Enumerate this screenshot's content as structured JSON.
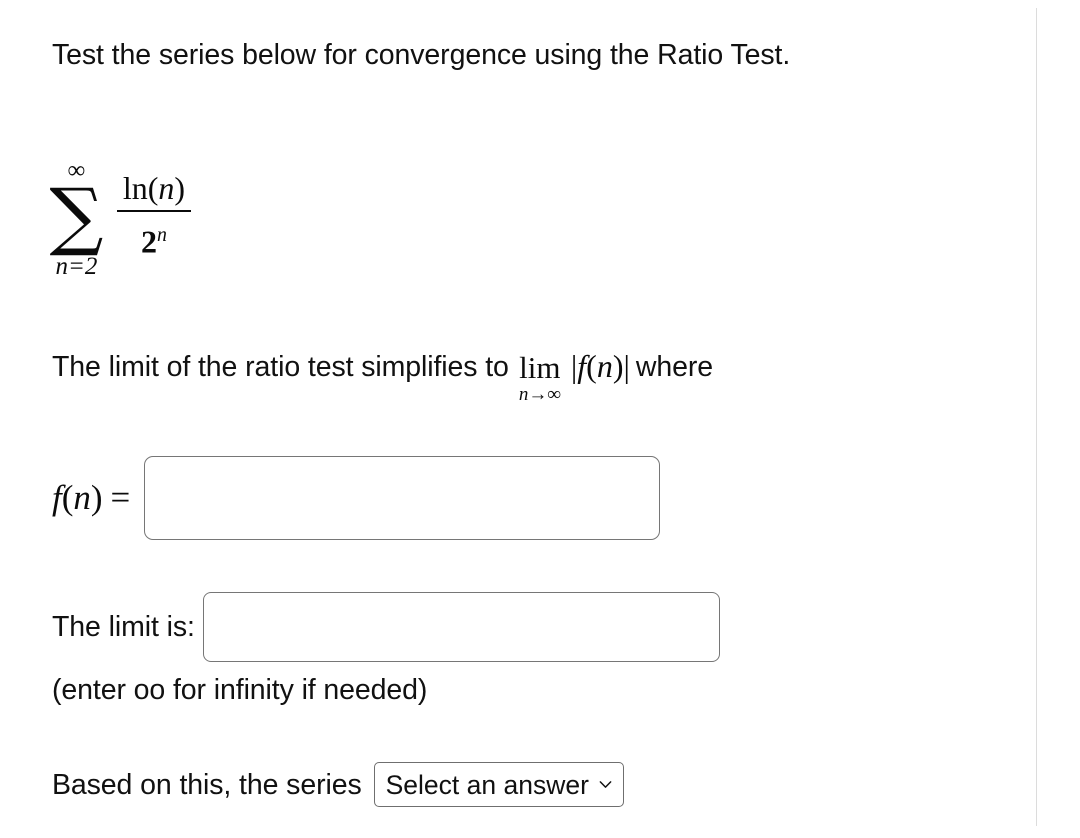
{
  "page": {
    "background_color": "#ffffff",
    "text_color": "#111111",
    "rule_color": "#dcdcdc"
  },
  "question": {
    "heading": "Test the series below for convergence using the Ratio Test."
  },
  "series": {
    "operator": "∑",
    "upper_limit": "∞",
    "lower_limit_var": "n",
    "lower_limit_eq": "=",
    "lower_limit_value": "2",
    "lower_limit_full": "n=2",
    "numerator_fn": "ln",
    "numerator_open": "(",
    "numerator_var": "n",
    "numerator_close": ")",
    "numerator_full": "ln(n)",
    "denominator_base": "2",
    "denominator_exponent": "n",
    "denominator_full": "2ⁿ",
    "plain_text": "sum from n=2 to infinity of ln(n)/2^n"
  },
  "limit_sentence": {
    "lead_text": "The limit of the ratio test simplifies to",
    "lim_operator": "lim",
    "lim_subscript_var": "n",
    "lim_subscript_arrow": "→",
    "lim_subscript_target": "∞",
    "lim_subscript_full": "n→∞",
    "abs_open": "|",
    "abs_fn": "f",
    "abs_paren_open": "(",
    "abs_var": "n",
    "abs_paren_close": ")",
    "abs_close": "|",
    "trailing_text": "where"
  },
  "fn_field": {
    "label_fn": "f",
    "label_paren_open": "(",
    "label_var": "n",
    "label_paren_close": ")",
    "label_equals": "=",
    "label_full": "f(n) =",
    "value": "",
    "placeholder": ""
  },
  "limit_field": {
    "label": "The limit is:",
    "value": "",
    "placeholder": "",
    "hint": "(enter oo for infinity if needed)"
  },
  "conclusion": {
    "label": "Based on this, the series",
    "select_value": "Select an answer",
    "chevron_icon": "chevron-down-icon"
  }
}
